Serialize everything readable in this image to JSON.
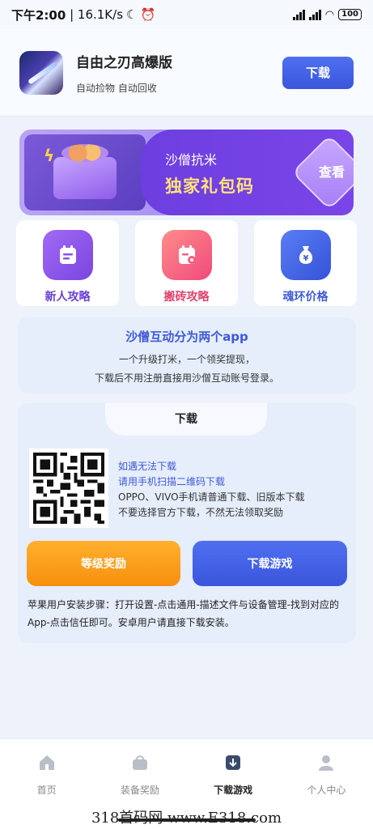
{
  "status_bar": {
    "time": "下午2:00",
    "speed": "16.1K/s",
    "battery": "100"
  },
  "header": {
    "app_icon": "game-icon",
    "title": "自由之刃高爆版",
    "subtitle": "自动捡物 自动回收",
    "download_label": "下载"
  },
  "banner": {
    "subtitle": "沙僧抗米",
    "title": "独家礼包码",
    "action_label": "查看"
  },
  "tiles": [
    {
      "label": "新人攻略",
      "icon": "clipboard-icon",
      "color": "#7b45e0"
    },
    {
      "label": "搬砖攻略",
      "icon": "calendar-icon",
      "color": "#f04a7a"
    },
    {
      "label": "魂环价格",
      "icon": "money-bag-icon",
      "color": "#3452d8"
    }
  ],
  "info": {
    "title": "沙僧互动分为两个app",
    "line1": "一个升级打米，一个领奖提现，",
    "line2": "下载后不用注册直接用沙僧互动账号登录。"
  },
  "download": {
    "tab_label": "下载",
    "qr_icon": "qr-code",
    "hint1": "如遇无法下载",
    "hint2": "请用手机扫描二维码下载",
    "hint3": "OPPO、VIVO手机请普通下载、旧版本下载",
    "hint4": "不要选择官方下载，不然无法领取奖励",
    "level_reward_label": "等级奖励",
    "download_game_label": "下载游戏",
    "note": "苹果用户安装步骤：打开设置-点击通用-描述文件与设备管理-找到对应的App-点击信任即可。安卓用户请直接下载安装。"
  },
  "bottom_nav": [
    {
      "label": "首页",
      "icon": "home-icon",
      "active": false
    },
    {
      "label": "装备奖励",
      "icon": "bag-icon",
      "active": false
    },
    {
      "label": "下载游戏",
      "icon": "download-box-icon",
      "active": true
    },
    {
      "label": "个人中心",
      "icon": "user-icon",
      "active": false
    }
  ],
  "watermark": "318首码网 www.E318.com",
  "colors": {
    "primary_blue": "#3a56dc",
    "orange": "#f6900e",
    "purple": "#6d3ee0",
    "background": "#eef3fb"
  }
}
